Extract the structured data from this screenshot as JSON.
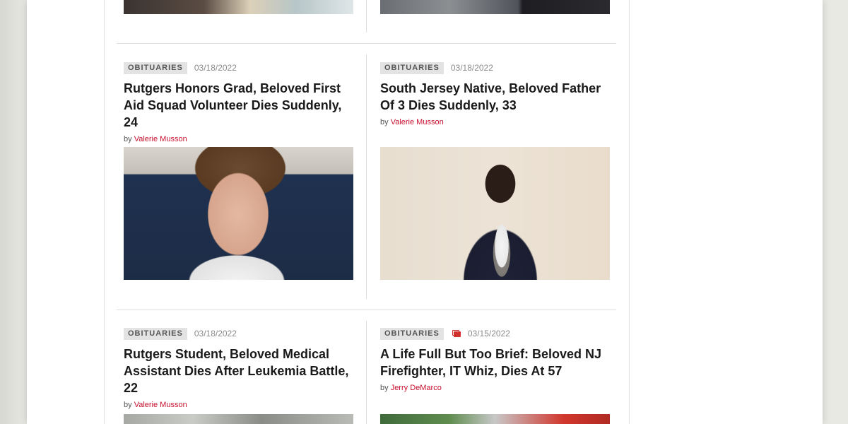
{
  "articles": [
    {
      "category": "OBITUARIES",
      "date": "03/18/2022",
      "title": "Rutgers Honors Grad, Beloved First Aid Squad Volunteer Dies Suddenly, 24",
      "by": "by",
      "author": "Valerie Musson"
    },
    {
      "category": "OBITUARIES",
      "date": "03/18/2022",
      "title": "South Jersey Native, Beloved Father Of 3 Dies Suddenly, 33",
      "by": "by",
      "author": "Valerie Musson"
    },
    {
      "category": "OBITUARIES",
      "date": "03/18/2022",
      "title": "Rutgers Student, Beloved Medical Assistant Dies After Leukemia Battle, 22",
      "by": "by",
      "author": "Valerie Musson"
    },
    {
      "category": "OBITUARIES",
      "gallery_icon": "photo-gallery-icon",
      "date": "03/15/2022",
      "title": "A Life Full But Too Brief: Beloved NJ Firefighter, IT Whiz, Dies At 57",
      "by": "by",
      "author": "Jerry DeMarco"
    }
  ],
  "colors": {
    "author_link": "#c8102e",
    "gallery_icon": "#d0312d",
    "category_bg": "#e3e3e3"
  }
}
